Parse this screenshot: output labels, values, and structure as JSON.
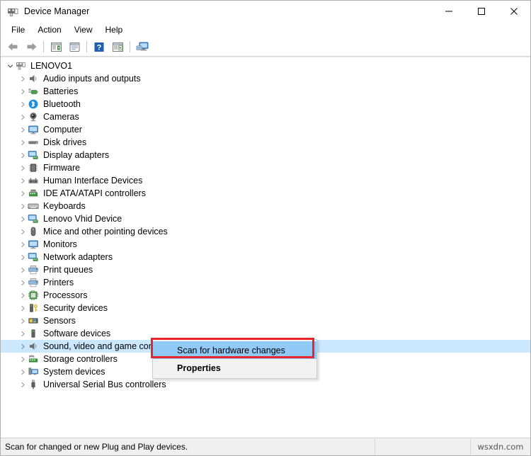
{
  "window": {
    "title": "Device Manager",
    "icon": "device-manager-icon",
    "controls": {
      "minimize": "minimize-icon",
      "maximize": "maximize-icon",
      "close": "close-icon"
    }
  },
  "menubar": {
    "items": [
      {
        "label": "File"
      },
      {
        "label": "Action"
      },
      {
        "label": "View"
      },
      {
        "label": "Help"
      }
    ]
  },
  "toolbar": {
    "buttons": [
      {
        "name": "back-arrow-icon"
      },
      {
        "name": "forward-arrow-icon"
      },
      {
        "name": "separator-1"
      },
      {
        "name": "show-hide-console-tree-icon"
      },
      {
        "name": "properties-icon"
      },
      {
        "name": "help-icon"
      },
      {
        "name": "update-driver-icon"
      },
      {
        "name": "separator-2"
      },
      {
        "name": "scan-hardware-changes-icon"
      }
    ]
  },
  "tree": {
    "root": {
      "label": "LENOVO1",
      "icon": "computer-device-icon",
      "expanded": true
    },
    "items": [
      {
        "label": "Audio inputs and outputs",
        "icon": "speaker-icon"
      },
      {
        "label": "Batteries",
        "icon": "battery-icon"
      },
      {
        "label": "Bluetooth",
        "icon": "bluetooth-icon"
      },
      {
        "label": "Cameras",
        "icon": "camera-icon"
      },
      {
        "label": "Computer",
        "icon": "monitor-icon"
      },
      {
        "label": "Disk drives",
        "icon": "disk-drive-icon"
      },
      {
        "label": "Display adapters",
        "icon": "display-adapter-icon"
      },
      {
        "label": "Firmware",
        "icon": "firmware-chip-icon"
      },
      {
        "label": "Human Interface Devices",
        "icon": "hid-icon"
      },
      {
        "label": "IDE ATA/ATAPI controllers",
        "icon": "ide-controller-icon"
      },
      {
        "label": "Keyboards",
        "icon": "keyboard-icon"
      },
      {
        "label": "Lenovo Vhid Device",
        "icon": "display-adapter-icon"
      },
      {
        "label": "Mice and other pointing devices",
        "icon": "mouse-icon"
      },
      {
        "label": "Monitors",
        "icon": "monitor-icon"
      },
      {
        "label": "Network adapters",
        "icon": "network-adapter-icon"
      },
      {
        "label": "Print queues",
        "icon": "printer-icon"
      },
      {
        "label": "Printers",
        "icon": "printer-icon"
      },
      {
        "label": "Processors",
        "icon": "processor-icon"
      },
      {
        "label": "Security devices",
        "icon": "security-device-icon"
      },
      {
        "label": "Sensors",
        "icon": "sensor-icon"
      },
      {
        "label": "Software devices",
        "icon": "software-device-icon"
      },
      {
        "label": "Sound, video and game controllers",
        "icon": "sound-controller-icon",
        "selected": true
      },
      {
        "label": "Storage controllers",
        "icon": "storage-controller-icon"
      },
      {
        "label": "System devices",
        "icon": "system-device-icon"
      },
      {
        "label": "Universal Serial Bus controllers",
        "icon": "usb-controller-icon"
      }
    ]
  },
  "context_menu": {
    "items": [
      {
        "label": "Scan for hardware changes",
        "highlighted": true,
        "bold": false
      },
      {
        "label": "Properties",
        "highlighted": false,
        "bold": true
      }
    ],
    "annotation_color": "#e8252a"
  },
  "statusbar": {
    "text": "Scan for changed or new Plug and Play devices.",
    "watermark": "wsxdn.com"
  },
  "colors": {
    "selection_blue": "#cce8ff",
    "menu_highlight_blue": "#91c9f7",
    "annotation_red": "#e8252a",
    "menu_bg": "#f2f2f2",
    "statusbar_bg": "#f0f0f0"
  }
}
